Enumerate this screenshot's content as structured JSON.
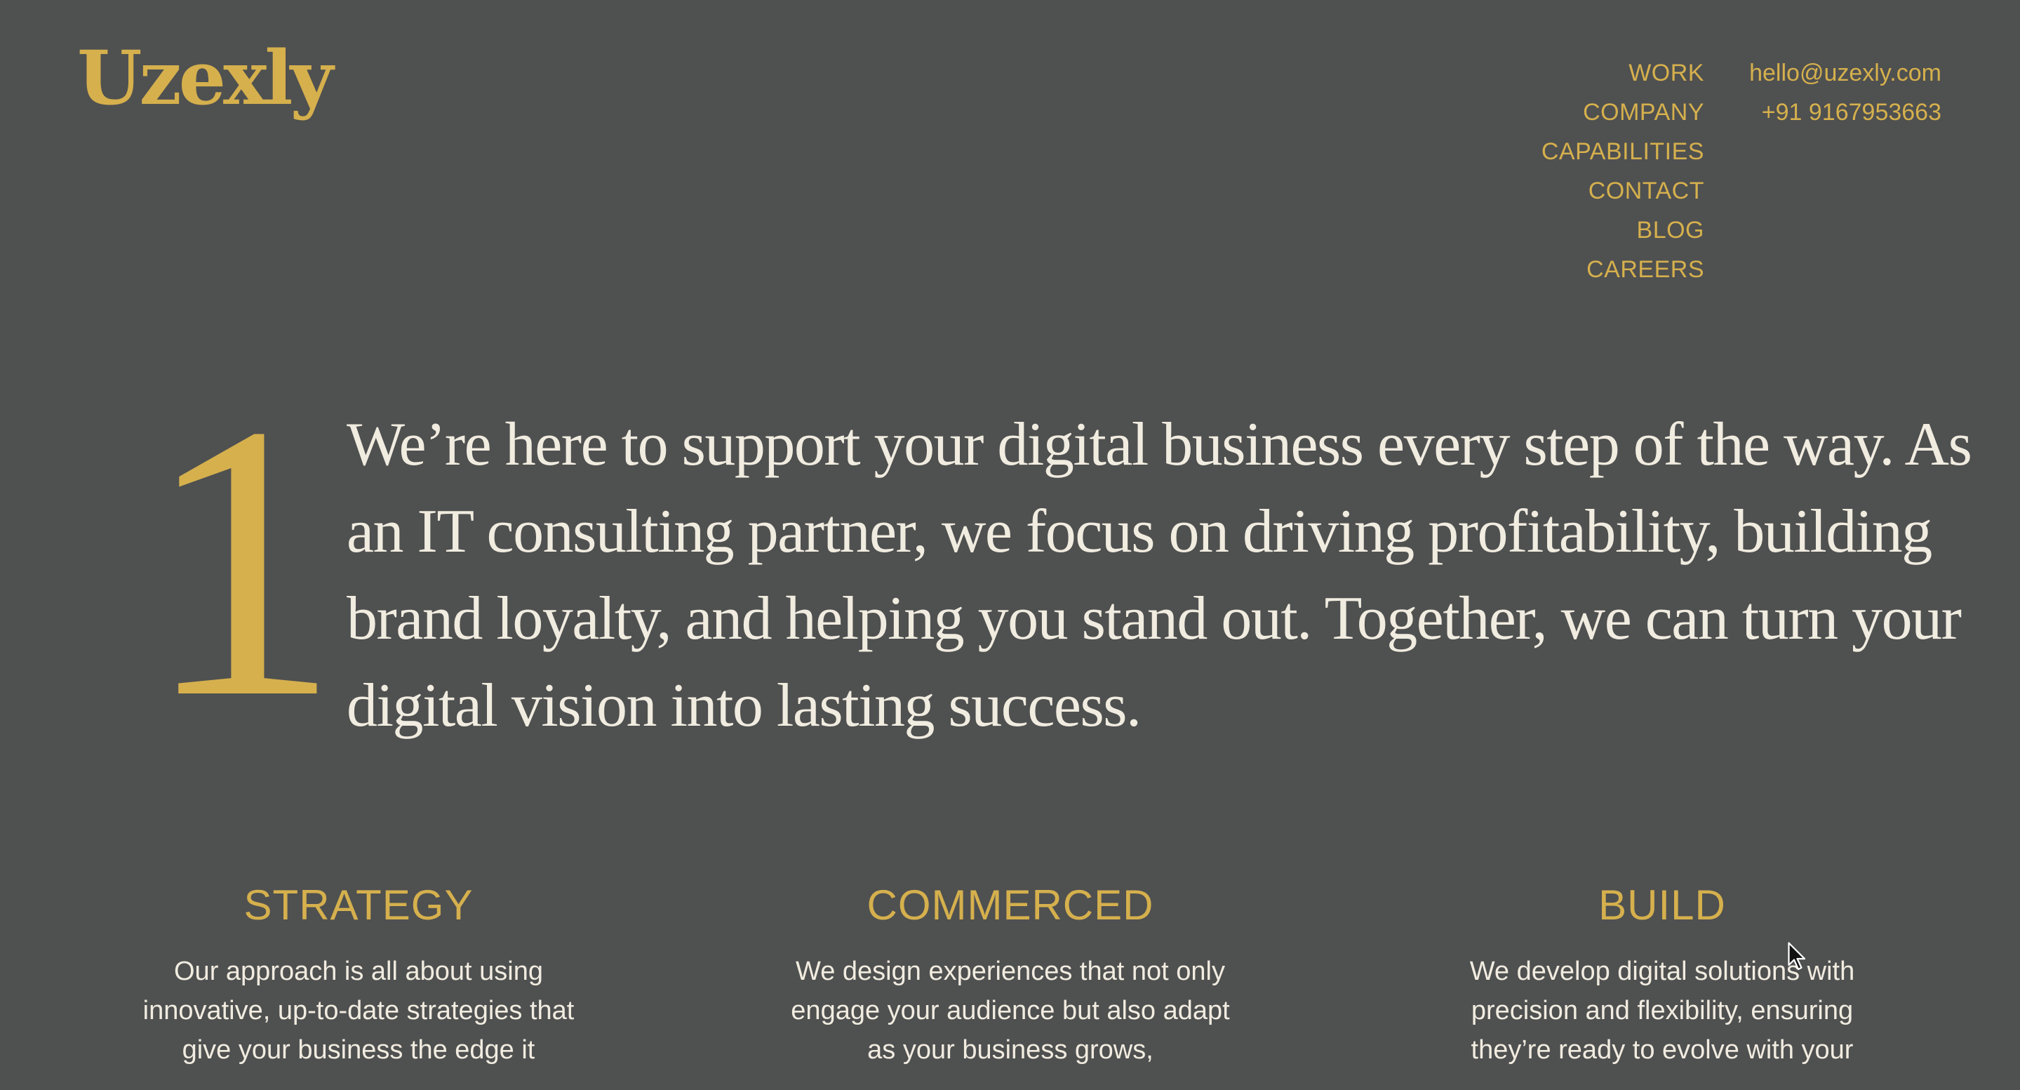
{
  "brand": {
    "logo": "Uzexly"
  },
  "nav": {
    "items": [
      "WORK",
      "COMPANY",
      "CAPABILITIES",
      "CONTACT",
      "BLOG",
      "CAREERS"
    ]
  },
  "contact": {
    "email": "hello@uzexly.com",
    "phone": "+91 9167953663"
  },
  "intro": {
    "dropcap": "1",
    "text": "We’re here to support your digital business every step of the way. As an IT consulting partner, we focus on driving profitability, building brand loyalty, and helping you stand out. Together, we can turn your digital vision into lasting success."
  },
  "services": [
    {
      "title": "STRATEGY",
      "body": "Our approach is all about using innovative, up-to-date strategies that give your business the edge it"
    },
    {
      "title": "COMMERCED",
      "body": "We design experiences that not only engage your audience but also adapt as your business grows,"
    },
    {
      "title": "BUILD",
      "body": "We develop digital solutions with precision and flexibility, ensuring they’re ready to evolve with your"
    }
  ],
  "colors": {
    "background": "#4f5050",
    "accent": "#d5b04d",
    "text": "#f1ece0"
  },
  "icons": {
    "cursor": "mouse-pointer-icon"
  }
}
